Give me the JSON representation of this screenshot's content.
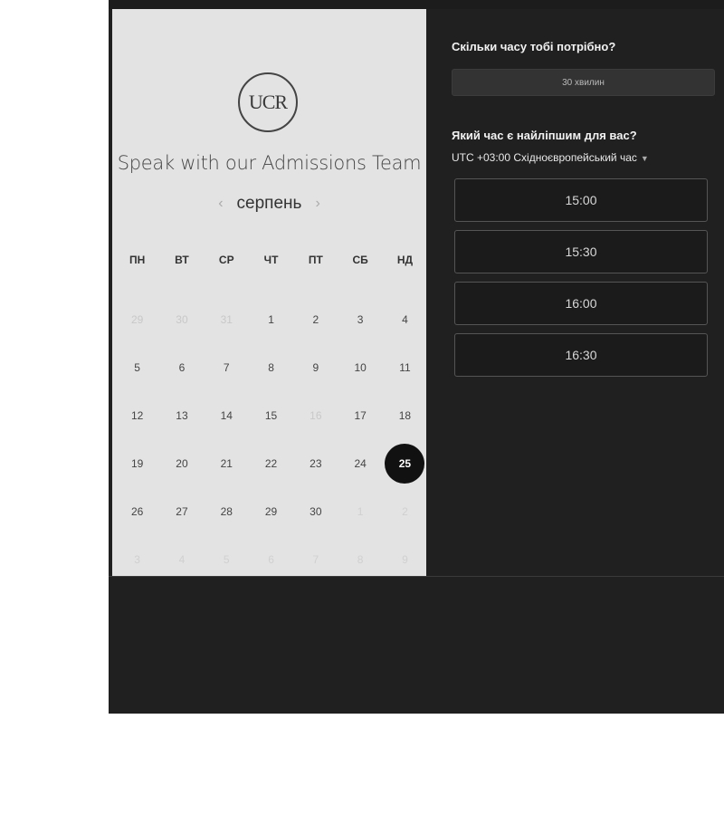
{
  "calendar": {
    "logo": "UCR",
    "heading": "Speak with our Admissions Team",
    "month": "серпень",
    "prev_icon": "chevron-left-icon",
    "next_icon": "chevron-right-icon",
    "weekdays": [
      "ПН",
      "ВТ",
      "СР",
      "ЧТ",
      "ПТ",
      "СБ",
      "НД"
    ],
    "days": [
      {
        "d": "29",
        "s": "muted"
      },
      {
        "d": "30",
        "s": "muted"
      },
      {
        "d": "31",
        "s": "muted"
      },
      {
        "d": "1",
        "s": ""
      },
      {
        "d": "2",
        "s": ""
      },
      {
        "d": "3",
        "s": ""
      },
      {
        "d": "4",
        "s": ""
      },
      {
        "d": "5",
        "s": ""
      },
      {
        "d": "6",
        "s": ""
      },
      {
        "d": "7",
        "s": ""
      },
      {
        "d": "8",
        "s": ""
      },
      {
        "d": "9",
        "s": ""
      },
      {
        "d": "10",
        "s": ""
      },
      {
        "d": "11",
        "s": ""
      },
      {
        "d": "12",
        "s": ""
      },
      {
        "d": "13",
        "s": ""
      },
      {
        "d": "14",
        "s": ""
      },
      {
        "d": "15",
        "s": ""
      },
      {
        "d": "16",
        "s": "muted"
      },
      {
        "d": "17",
        "s": ""
      },
      {
        "d": "18",
        "s": ""
      },
      {
        "d": "19",
        "s": ""
      },
      {
        "d": "20",
        "s": ""
      },
      {
        "d": "21",
        "s": ""
      },
      {
        "d": "22",
        "s": ""
      },
      {
        "d": "23",
        "s": ""
      },
      {
        "d": "24",
        "s": ""
      },
      {
        "d": "25",
        "s": "selected"
      },
      {
        "d": "26",
        "s": ""
      },
      {
        "d": "27",
        "s": ""
      },
      {
        "d": "28",
        "s": ""
      },
      {
        "d": "29",
        "s": ""
      },
      {
        "d": "30",
        "s": ""
      },
      {
        "d": "1",
        "s": "faded"
      },
      {
        "d": "2",
        "s": "faded"
      },
      {
        "d": "3",
        "s": "faded"
      },
      {
        "d": "4",
        "s": "faded"
      },
      {
        "d": "5",
        "s": "faded"
      },
      {
        "d": "6",
        "s": "faded"
      },
      {
        "d": "7",
        "s": "faded"
      },
      {
        "d": "8",
        "s": "faded"
      },
      {
        "d": "9",
        "s": "faded"
      }
    ]
  },
  "booking": {
    "duration_question": "Скільки часу тобі потрібно?",
    "duration_value": "30 хвилин",
    "time_question": "Який час є найліпшим для вас?",
    "timezone": "UTC +03:00 Східноєвропейський час",
    "timezone_icon": "caret-down-icon",
    "slots": [
      "15:00",
      "15:30",
      "16:00",
      "16:30"
    ]
  },
  "colors": {
    "panel_light": "#e3e3e3",
    "panel_dark": "#202020",
    "selected_day": "#111111"
  }
}
